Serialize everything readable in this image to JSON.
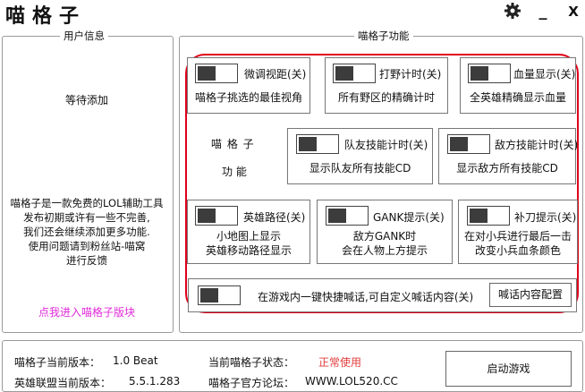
{
  "app": {
    "title": "喵格子"
  },
  "window_controls": {
    "settings_icon": "gear-icon",
    "minimize": "_",
    "close": "X"
  },
  "user_panel": {
    "legend": "用户信息",
    "waiting": "等待添加",
    "intro_lines": [
      "喵格子是一款免费的LOL辅助工具",
      "发布初期或许有一些不完善,",
      "我们还会继续添加更多功能.",
      "使用问题请到粉丝站-喵窝",
      "进行反馈"
    ],
    "enter_link": "点我进入喵格子版块"
  },
  "features_panel": {
    "legend": "喵格子功能",
    "side_title": "喵 格 子",
    "side_subtitle": "功 能",
    "cards": [
      {
        "id": "camera",
        "label": "微调视距(关)",
        "desc": [
          "喵格子挑选的最佳视角"
        ]
      },
      {
        "id": "jungle",
        "label": "打野计时(关)",
        "desc": [
          "所有野区的精确计时"
        ]
      },
      {
        "id": "hp",
        "label": "血量显示(关)",
        "desc": [
          "全英雄精确显示血量"
        ]
      },
      {
        "id": "ally",
        "label": "队友技能计时(关)",
        "desc": [
          "显示队友所有技能CD"
        ]
      },
      {
        "id": "enemy",
        "label": "敌方技能计时(关)",
        "desc": [
          "显示敌方所有技能CD"
        ]
      },
      {
        "id": "path",
        "label": "英雄路径(关)",
        "desc": [
          "小地图上显示",
          "英雄移动路径显示"
        ]
      },
      {
        "id": "gank",
        "label": "GANK提示(关)",
        "desc": [
          "敌方GANK时",
          "会在人物上方提示"
        ]
      },
      {
        "id": "lasthit",
        "label": "补刀提示(关)",
        "desc": [
          "在对小兵进行最后一击",
          "改变小兵血条颜色"
        ]
      }
    ],
    "shout": {
      "label": "在游戏内一键快捷喊话,可自定义喊话内容(关)",
      "config_button": "喊话内容配置"
    },
    "highlight_color": "#e0001a"
  },
  "footer": {
    "current_version_label": "喵格子当前版本：",
    "current_version": "1.0 Beat",
    "lol_version_label": "英雄联盟当前版本：",
    "lol_version": "5.5.1.283",
    "status_label": "当前喵格子状态：",
    "status": "正常使用",
    "forum_label": "喵格子官方论坛：",
    "forum": "WWW.LOL520.CC",
    "launch_button": "启动游戏"
  },
  "colors": {
    "link": "#e02ad8",
    "status": "#e23d3d",
    "knob": "#3c3c3c"
  }
}
